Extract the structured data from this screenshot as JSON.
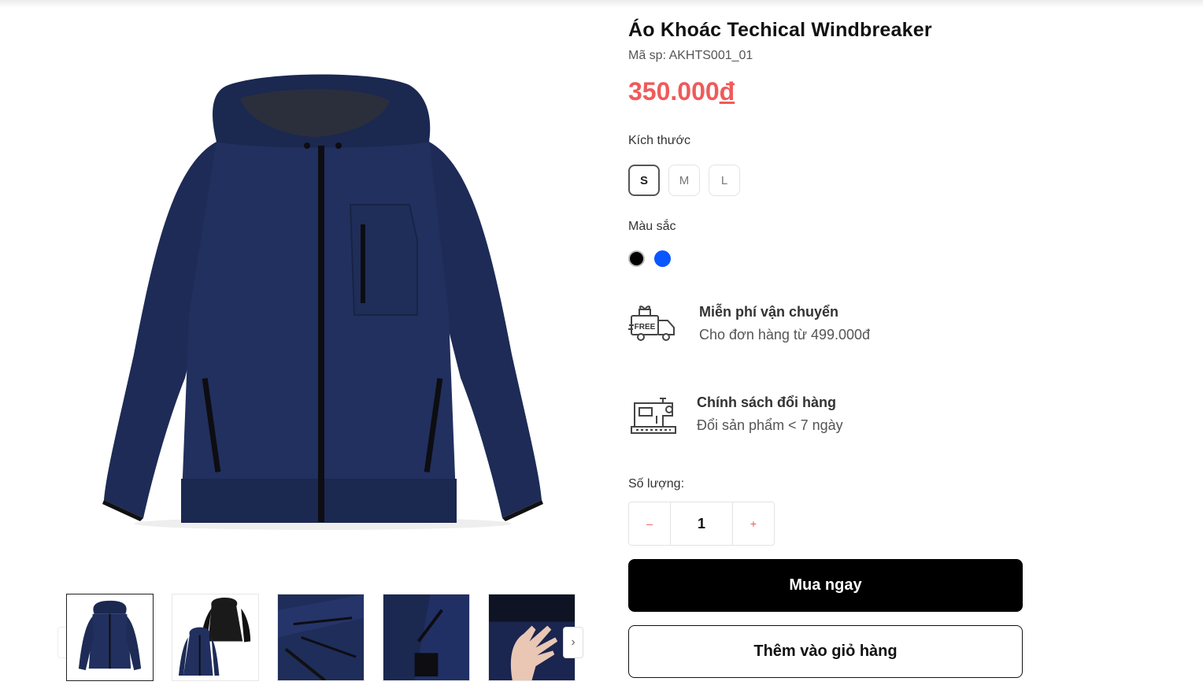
{
  "product": {
    "title": "Áo Khoác Techical Windbreaker",
    "sku": "Mã sp: AKHTS001_01",
    "price": "350.000",
    "currency": "đ",
    "price_color": "#f05a5a"
  },
  "main_image": {
    "icon": "jacket-image",
    "color": "#1d2b56"
  },
  "thumbnails": [
    {
      "icon": "jacket-front-thumbnail",
      "active": true
    },
    {
      "icon": "jacket-pair-thumbnail",
      "active": false
    },
    {
      "icon": "jacket-detail-thumbnail",
      "active": false
    },
    {
      "icon": "jacket-pocket-thumbnail",
      "active": false
    },
    {
      "icon": "jacket-hand-thumbnail",
      "active": false
    }
  ],
  "gallery_nav": {
    "prev": "‹",
    "next": "›"
  },
  "size": {
    "label": "Kích thước",
    "options": [
      "S",
      "M",
      "L"
    ],
    "selected": "S"
  },
  "color": {
    "label": "Màu sắc",
    "options": [
      {
        "name": "black",
        "hex": "#000000"
      },
      {
        "name": "blue",
        "hex": "#0a57ff"
      }
    ]
  },
  "features": {
    "shipping": {
      "title": "Miễn phí vận chuyển",
      "subtitle": "Cho đơn hàng từ 499.000đ",
      "icon": "free-truck-icon",
      "badge": "FREE"
    },
    "exchange": {
      "title": "Chính sách đổi hàng",
      "subtitle": "Đổi sản phẩm < 7 ngày",
      "icon": "sewing-machine-icon"
    }
  },
  "quantity": {
    "label": "Số lượng:",
    "value": "1",
    "minus": "–",
    "plus": "+"
  },
  "actions": {
    "buy_now": "Mua ngay",
    "add_to_cart": "Thêm vào giỏ hàng"
  }
}
